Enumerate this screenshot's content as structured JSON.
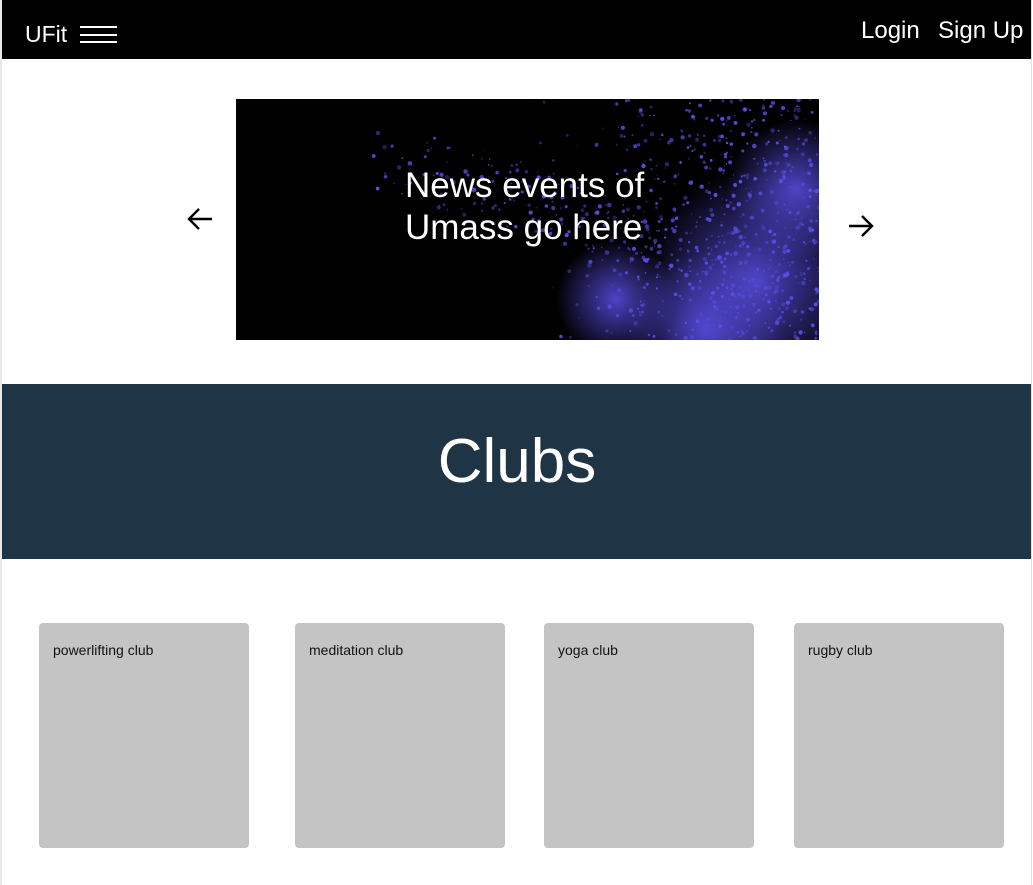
{
  "nav": {
    "brand": "UFit",
    "menu_icon": "hamburger-menu-icon",
    "login": "Login",
    "signup": "Sign Up"
  },
  "carousel": {
    "prev_icon": "arrow-left-icon",
    "next_icon": "arrow-right-icon",
    "banner_text": "News events of Umass go here",
    "particle_color": "#5a4fe6"
  },
  "clubs": {
    "title": "Clubs",
    "items": [
      {
        "name": "powerlifting club"
      },
      {
        "name": "meditation club"
      },
      {
        "name": "yoga club"
      },
      {
        "name": "rugby club"
      }
    ]
  },
  "colors": {
    "navbar": "#000000",
    "clubs_header": "#1f3444",
    "card": "#c4c4c4"
  }
}
